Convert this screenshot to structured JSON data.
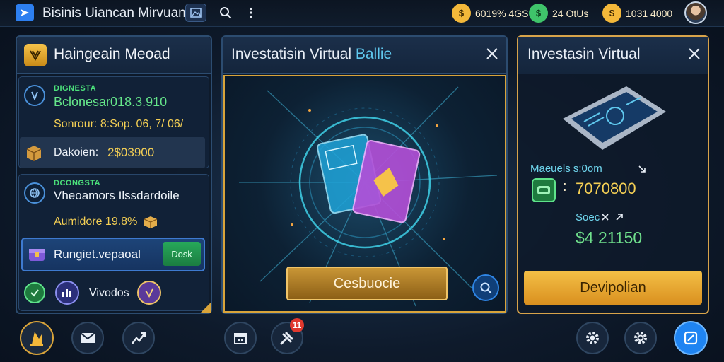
{
  "app": {
    "title": "Bisinis Uiancan Mirvuan"
  },
  "topbar": {
    "currencies": [
      {
        "glyph": "$",
        "value": "6019% 4GS",
        "color": "#f3b83a"
      },
      {
        "glyph": "$",
        "value": "24  OtUs",
        "color": "#3fc46a"
      },
      {
        "glyph": "$",
        "value": "1031  4000",
        "color": "#f3b83a"
      }
    ]
  },
  "left_panel": {
    "title": "Haingeain Meoad",
    "card1": {
      "label": "DIGNESTA",
      "balance": "Bclonesar018.3.910",
      "sub": "Sonrour:  8:Sop. 06, 7/ 06/"
    },
    "row": {
      "label": "Dakoien:",
      "value": "2$03900"
    },
    "card2": {
      "label": "DCONGSTA",
      "title": "Vheoamors Ilssdardoile",
      "sub": "Aumidore  19.8%"
    },
    "rewards": {
      "label": "Rungiet.vepaoal",
      "button": "Dosk"
    },
    "footer": {
      "label": "Vivodos"
    }
  },
  "center_panel": {
    "title_main": "Investatisin Virtual",
    "title_accent": "Ballie",
    "button": "Cesbuocie"
  },
  "right_panel": {
    "title": "Investasin Virtual",
    "metric1": {
      "label": "Maeuels s:0om",
      "value": "7070800"
    },
    "metric2": {
      "label": "Soec",
      "value": "$4  21150"
    },
    "button": "Devipolian"
  },
  "bottom_bar": {
    "badge_count": "11"
  },
  "colors": {
    "accent": "#2d7ff0",
    "gold": "#d9a43a",
    "green": "#65e68a",
    "yellow": "#f4cf54"
  }
}
